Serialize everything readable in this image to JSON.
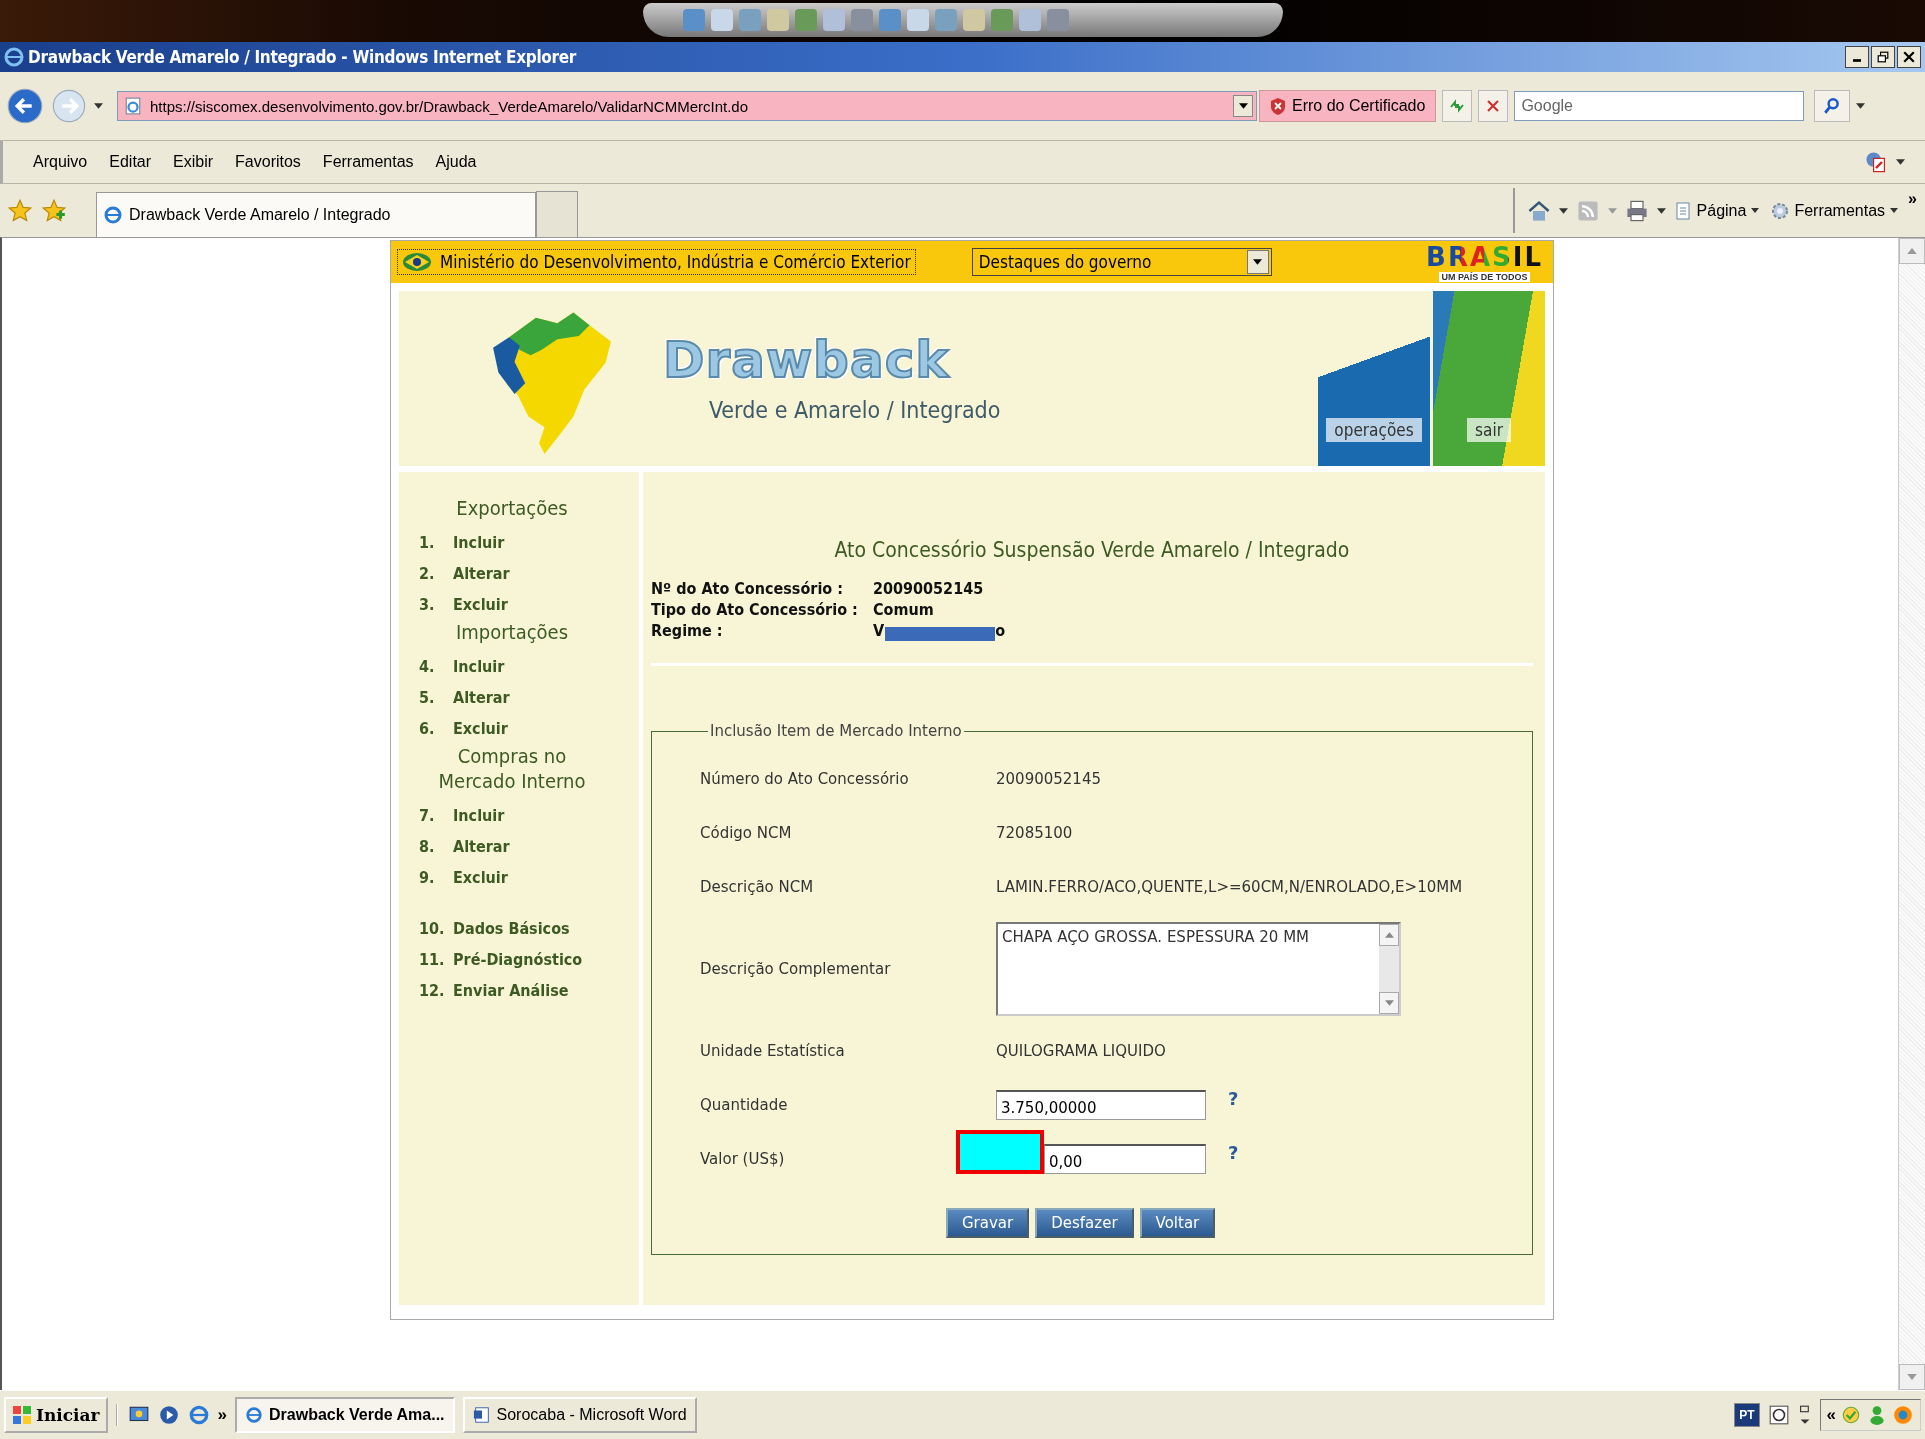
{
  "window": {
    "title": "Drawback Verde Amarelo / Integrado - Windows Internet Explorer"
  },
  "address_bar": {
    "url": "https://siscomex.desenvolvimento.gov.br/Drawback_VerdeAmarelo/ValidarNCMMercInt.do",
    "certificate_error": "Erro do Certificado"
  },
  "search": {
    "placeholder": "Google"
  },
  "menu": [
    "Arquivo",
    "Editar",
    "Exibir",
    "Favoritos",
    "Ferramentas",
    "Ajuda"
  ],
  "tabs": [
    {
      "label": "Drawback Verde Amarelo / Integrado",
      "selected": true
    }
  ],
  "command_bar": {
    "items": [
      "Página",
      "Ferramentas"
    ],
    "overflow": "»"
  },
  "gov_bar": {
    "ministry": "Ministério do Desenvolvimento, Indústria e Comércio Exterior",
    "dropdown": "Destaques do governo",
    "logo": "BRASIL",
    "logo_tagline": "UM PAÍS DE TODOS"
  },
  "header": {
    "title": "Drawback",
    "subtitle": "Verde e Amarelo / Integrado",
    "links": [
      "operações",
      "sair"
    ]
  },
  "sidebar": {
    "sections": [
      {
        "title": "Exportações",
        "items": [
          {
            "number": "1.",
            "label": "Incluir"
          },
          {
            "number": "2.",
            "label": "Alterar"
          },
          {
            "number": "3.",
            "label": "Excluir"
          }
        ]
      },
      {
        "title": "Importações",
        "items": [
          {
            "number": "4.",
            "label": "Incluir"
          },
          {
            "number": "5.",
            "label": "Alterar"
          },
          {
            "number": "6.",
            "label": "Excluir"
          }
        ]
      },
      {
        "title": "Compras no Mercado Interno",
        "items": [
          {
            "number": "7.",
            "label": "Incluir"
          },
          {
            "number": "8.",
            "label": "Alterar"
          },
          {
            "number": "9.",
            "label": "Excluir"
          }
        ]
      },
      {
        "items": [
          {
            "number": "10.",
            "label": "Dados Básicos"
          },
          {
            "number": "11.",
            "label": "Pré-Diagnóstico"
          },
          {
            "number": "12.",
            "label": "Enviar Análise"
          }
        ]
      }
    ]
  },
  "content": {
    "title": "Ato Concessório Suspensão Verde Amarelo / Integrado",
    "info": [
      {
        "kind": "plain",
        "label": "Nº do Ato Concessório :",
        "value": "20090052145"
      },
      {
        "kind": "plain",
        "label": "Tipo do Ato Concessório :",
        "value": "Comum"
      },
      {
        "kind": "redacted",
        "label": "Regime :",
        "value_parts": [
          "V",
          "o"
        ]
      }
    ]
  },
  "form": {
    "legend": "Inclusão Item de Mercado Interno",
    "rows": [
      {
        "kind": "text",
        "label": "Número do Ato Concessório",
        "value": "20090052145"
      },
      {
        "kind": "text",
        "label": "Código NCM",
        "value": "72085100"
      },
      {
        "kind": "text",
        "label": "Descrição NCM",
        "value": "LAMIN.FERRO/ACO,QUENTE,L>=60CM,N/ENROLADO,E>10MM"
      },
      {
        "kind": "textarea",
        "label": "Descrição Complementar",
        "value": "CHAPA AÇO GROSSA. ESPESSURA 20 MM"
      },
      {
        "kind": "text",
        "label": "Unidade Estatística",
        "value": "QUILOGRAMA LIQUIDO"
      },
      {
        "kind": "input",
        "label": "Quantidade",
        "value": "3.750,00000",
        "help": "?",
        "redacted": false
      },
      {
        "kind": "input",
        "label": "Valor (US$)",
        "value": "0,00",
        "help": "?",
        "redacted": true
      }
    ],
    "buttons": [
      "Gravar",
      "Desfazer",
      "Voltar"
    ]
  },
  "taskbar": {
    "start": "Iniciar",
    "overflow": "»",
    "tasks": [
      {
        "label": "Drawback Verde Ama...",
        "selected": true
      },
      {
        "label": "Sorocaba - Microsoft Word",
        "selected": false
      }
    ],
    "language": "PT",
    "tray_overflow": "«"
  }
}
